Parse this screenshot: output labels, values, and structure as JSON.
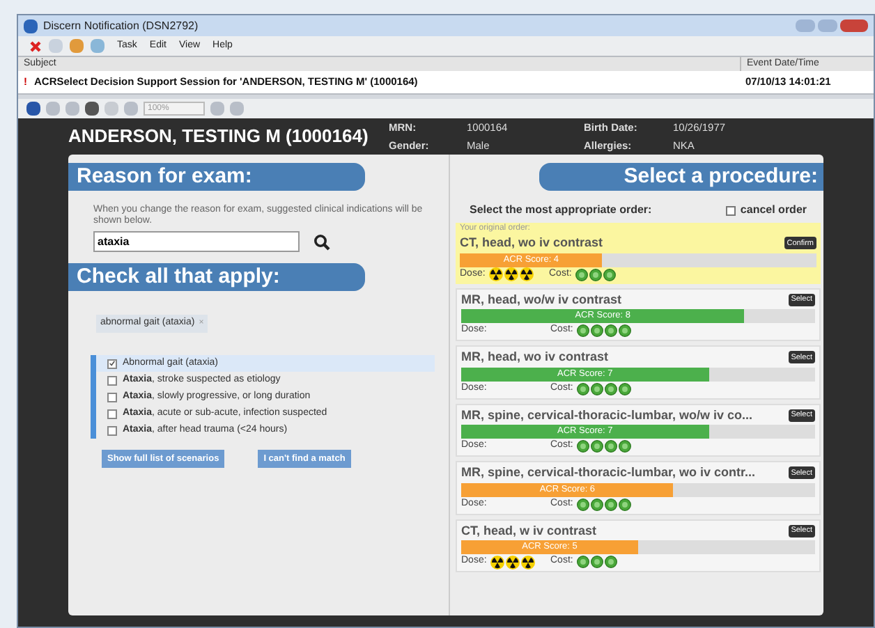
{
  "window": {
    "title": "Discern Notification (DSN2792)"
  },
  "menu": [
    "Task",
    "Edit",
    "View",
    "Help"
  ],
  "notification": {
    "subject_header": "Subject",
    "date_header": "Event Date/Time",
    "priority": "!",
    "subject": "ACRSelect Decision Support Session for 'ANDERSON, TESTING M' (1000164)",
    "date": "07/10/13 14:01:21"
  },
  "zoom": "100%",
  "patient": {
    "name": "ANDERSON, TESTING M (1000164)",
    "fields": [
      {
        "label": "MRN:",
        "value": "1000164"
      },
      {
        "label": "Birth Date:",
        "value": "10/26/1977"
      },
      {
        "label": "Gender:",
        "value": "Male"
      },
      {
        "label": "Allergies:",
        "value": "NKA"
      }
    ]
  },
  "reason": {
    "title": "Reason for exam:",
    "hint": "When you change the reason for exam, suggested clinical indications will be shown below.",
    "value": "ataxia"
  },
  "indications": {
    "title": "Check all that apply:",
    "tag": "abnormal gait (ataxia)",
    "tag_remove": "×",
    "items": [
      {
        "label": "Abnormal gait (ataxia)",
        "checked": true,
        "selected": true
      },
      {
        "label": "**Ataxia**, stroke suspected as etiology",
        "checked": false,
        "selected": false
      },
      {
        "label": "**Ataxia**, slowly progressive, or long duration",
        "checked": false,
        "selected": false
      },
      {
        "label": "**Ataxia**, acute or sub-acute, infection suspected",
        "checked": false,
        "selected": false
      },
      {
        "label": "**Ataxia**, after head trauma (<24 hours)",
        "checked": false,
        "selected": false
      }
    ],
    "buttons": [
      "Show full list of scenarios",
      "I can't find a match"
    ]
  },
  "procedures": {
    "title": "Select a procedure:",
    "prompt": "Select the most appropriate order:",
    "cancel": {
      "label": "cancel order",
      "checked": false
    },
    "items": [
      {
        "original_label": "Your original order:",
        "name": "CT, head, wo iv contrast",
        "button": "Confirm",
        "score": "ACR Score: 4",
        "level": 0.4,
        "color": "#f7a035",
        "dose_label": "Dose:",
        "dose": {
          "stars": 3
        },
        "cost_label": "Cost:",
        "cost": {
          "stars": 3
        }
      },
      {
        "name": "MR, head, wo/w iv contrast",
        "button": "Select",
        "score": "ACR Score: 8",
        "level": 0.8,
        "color": "#4cb04c",
        "dose_label": "Dose:",
        "cost_label": "Cost:",
        "cost": {
          "stars": 4
        }
      },
      {
        "name": "MR, head, wo iv contrast",
        "button": "Select",
        "score": "ACR Score: 7",
        "level": 0.7,
        "color": "#4cb04c",
        "dose_label": "Dose:",
        "cost_label": "Cost:",
        "cost": {
          "stars": 4
        }
      },
      {
        "name": "MR, spine, cervical-thoracic-lumbar, wo/w iv co...",
        "button": "Select",
        "score": "ACR Score: 7",
        "level": 0.7,
        "color": "#4cb04c",
        "dose_label": "Dose:",
        "cost_label": "Cost:",
        "cost": {
          "stars": 4
        }
      },
      {
        "name": "MR, spine, cervical-thoracic-lumbar, wo iv contr...",
        "button": "Select",
        "score": "ACR Score: 6",
        "level": 0.6,
        "color": "#f7a035",
        "dose_label": "Dose:",
        "cost_label": "Cost:",
        "cost": {
          "stars": 4
        }
      },
      {
        "name": "CT, head, w iv contrast",
        "button": "Select",
        "score": "ACR Score: 5",
        "level": 0.5,
        "color": "#f7a035",
        "dose_label": "Dose:",
        "dose": {
          "stars": 3
        },
        "cost_label": "Cost:",
        "cost": {
          "stars": 3
        }
      }
    ]
  }
}
